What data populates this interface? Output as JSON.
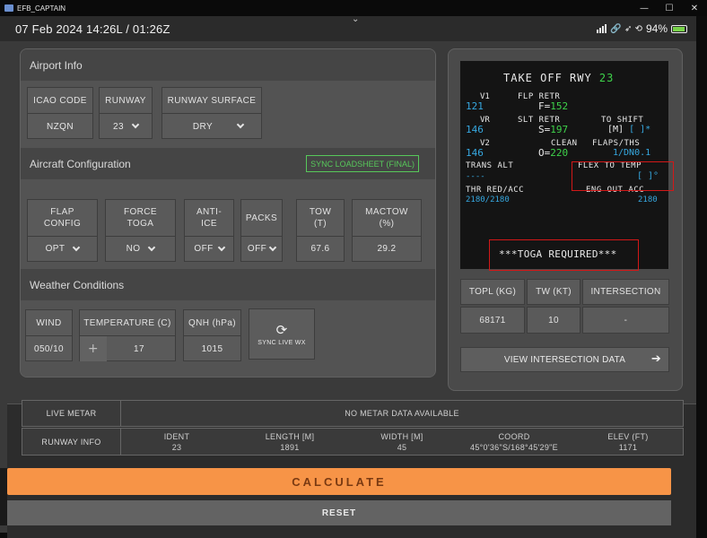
{
  "window": {
    "title": "EFB_CAPTAIN",
    "minimize": "—",
    "maximize": "☐",
    "close": "✕"
  },
  "statusbar": {
    "datetime": "07 Feb 2024   14:26L / 01:26Z",
    "pull_indicator": "⌄",
    "icons": "🔗 ➶ ⟲",
    "battery": "94%"
  },
  "airport_info": {
    "title": "Airport Info",
    "icao_label": "ICAO CODE",
    "icao_value": "NZQN",
    "runway_label": "RUNWAY",
    "runway_value": "23",
    "surface_label": "RUNWAY SURFACE",
    "surface_value": "DRY"
  },
  "aircraft_config": {
    "title": "Aircraft Configuration",
    "sync_loadsheet": "SYNC LOADSHEET (FINAL)",
    "flap_label_1": "FLAP",
    "flap_label_2": "CONFIG",
    "flap_value": "OPT",
    "toga_label_1": "FORCE",
    "toga_label_2": "TOGA",
    "toga_value": "NO",
    "anti_label_1": "ANTI-",
    "anti_label_2": "ICE",
    "anti_value": "OFF",
    "packs_label": "PACKS",
    "packs_value": "OFF",
    "tow_label_1": "TOW",
    "tow_label_2": "(T)",
    "tow_value": "67.6",
    "mactow_label_1": "MACTOW",
    "mactow_label_2": "(%)",
    "mactow_value": "29.2"
  },
  "weather": {
    "title": "Weather Conditions",
    "wind_label": "WIND",
    "wind_value": "050/10",
    "temp_label": "TEMPERATURE (C)",
    "temp_plus": "+",
    "temp_value": "17",
    "qnh_label": "QNH (hPa)",
    "qnh_value": "1015",
    "sync_wx_icon": "⟳",
    "sync_wx_label": "SYNC LIVE WX"
  },
  "mcdu": {
    "title_a": "TAKE OFF RWY ",
    "title_rwy": "23",
    "v1_label": "V1",
    "v1_value": "121",
    "flp_retr_label": "FLP RETR",
    "flp_retr_value_prefix": "F=",
    "flp_retr_value": "152",
    "vr_label": "VR",
    "vr_value": "146",
    "slt_retr_label": "SLT RETR",
    "slt_retr_value_prefix": "S=",
    "slt_retr_value": "197",
    "to_shift_label": "TO SHIFT",
    "to_shift_prefix": "[M] ",
    "to_shift_value": "[ ]*",
    "v2_label": "V2",
    "v2_value": "146",
    "clean_label": "CLEAN",
    "clean_value_prefix": "O=",
    "clean_value": "220",
    "flaps_ths_label": "FLAPS/THS",
    "flaps_ths_value": "1/DN0.1",
    "trans_alt_label": "TRANS ALT",
    "trans_alt_value": "----",
    "flex_label": "FLEX TO TEMP",
    "flex_value": "[ ]°",
    "thr_red_label": "THR RED/ACC",
    "thr_red_value": "2180/2180",
    "eng_out_label": "ENG OUT ACC",
    "eng_out_value": "2180",
    "toga_msg": "***TOGA REQUIRED***"
  },
  "results": {
    "topl_label": "TOPL (KG)",
    "topl_value": "68171",
    "tw_label": "TW (KT)",
    "tw_value": "10",
    "intersection_label": "INTERSECTION",
    "intersection_value": "-",
    "view_intersection": "VIEW INTERSECTION DATA",
    "view_arrow": "➔"
  },
  "live_metar": {
    "label": "LIVE METAR",
    "value": "NO METAR DATA AVAILABLE"
  },
  "runway_info": {
    "label": "RUNWAY INFO",
    "ident_label": "IDENT",
    "ident_value": "23",
    "length_label": "LENGTH [M]",
    "length_value": "1891",
    "width_label": "WIDTH [M]",
    "width_value": "45",
    "coord_label": "COORD",
    "coord_value": "45°0'36\"S/168°45'29\"E",
    "elev_label": "ELEV (FT)",
    "elev_value": "1171"
  },
  "buttons": {
    "calculate": "CALCULATE",
    "reset": "RESET"
  },
  "colors": {
    "accent_orange": "#f79447",
    "mcdu_green": "#3ed24a",
    "mcdu_cyan": "#36a8e0",
    "alert_red": "#d21818",
    "sync_green": "#57c85a"
  }
}
